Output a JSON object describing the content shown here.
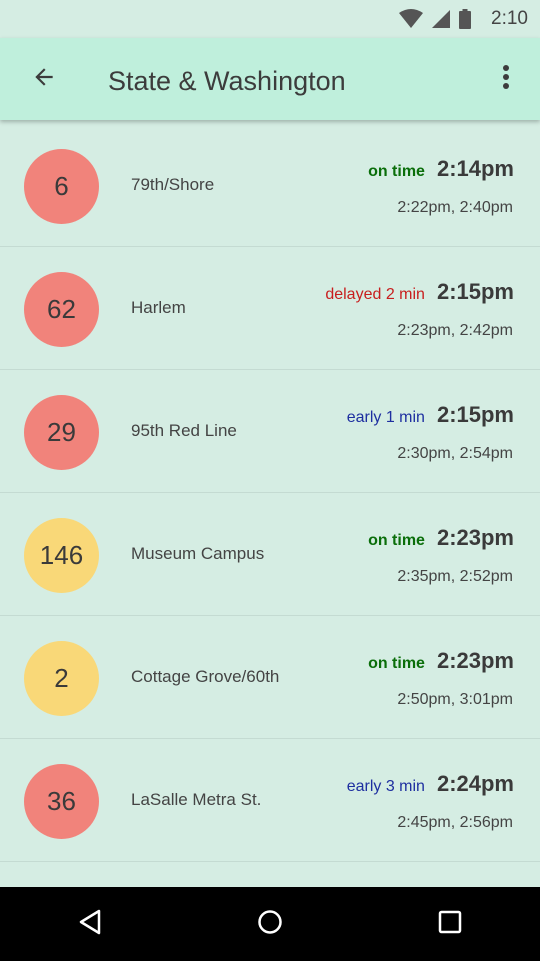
{
  "status_bar": {
    "time": "2:10",
    "icons": [
      "wifi-icon",
      "cell-signal-icon",
      "battery-icon"
    ]
  },
  "app_bar": {
    "title": "State & Washington",
    "back_icon": "arrow-back-icon",
    "menu_icon": "more-vert-icon"
  },
  "colors": {
    "on_time": "#0a6e0a",
    "delayed": "#c81e1e",
    "early": "#1e2fa0",
    "badge_red": "#f1837b",
    "badge_yellow": "#f9d878"
  },
  "routes": [
    {
      "route": "6",
      "destination": "79th/Shore",
      "status": "on time",
      "status_type": "on_time",
      "time": "2:14pm",
      "next_times": "2:22pm, 2:40pm",
      "badge_color": "#f1837b"
    },
    {
      "route": "62",
      "destination": "Harlem",
      "status": "delayed 2 min",
      "status_type": "delayed",
      "time": "2:15pm",
      "next_times": "2:23pm, 2:42pm",
      "badge_color": "#f1837b"
    },
    {
      "route": "29",
      "destination": "95th Red Line",
      "status": "early 1 min",
      "status_type": "early",
      "time": "2:15pm",
      "next_times": "2:30pm, 2:54pm",
      "badge_color": "#f1837b"
    },
    {
      "route": "146",
      "destination": "Museum Campus",
      "status": "on time",
      "status_type": "on_time",
      "time": "2:23pm",
      "next_times": "2:35pm, 2:52pm",
      "badge_color": "#f9d878"
    },
    {
      "route": "2",
      "destination": "Cottage Grove/60th",
      "status": "on time",
      "status_type": "on_time",
      "time": "2:23pm",
      "next_times": "2:50pm, 3:01pm",
      "badge_color": "#f9d878"
    },
    {
      "route": "36",
      "destination": "LaSalle Metra St.",
      "status": "early 3 min",
      "status_type": "early",
      "time": "2:24pm",
      "next_times": "2:45pm, 2:56pm",
      "badge_color": "#f1837b"
    }
  ],
  "nav_bar": {
    "back_icon": "nav-back-icon",
    "home_icon": "nav-home-icon",
    "recents_icon": "nav-recents-icon"
  }
}
